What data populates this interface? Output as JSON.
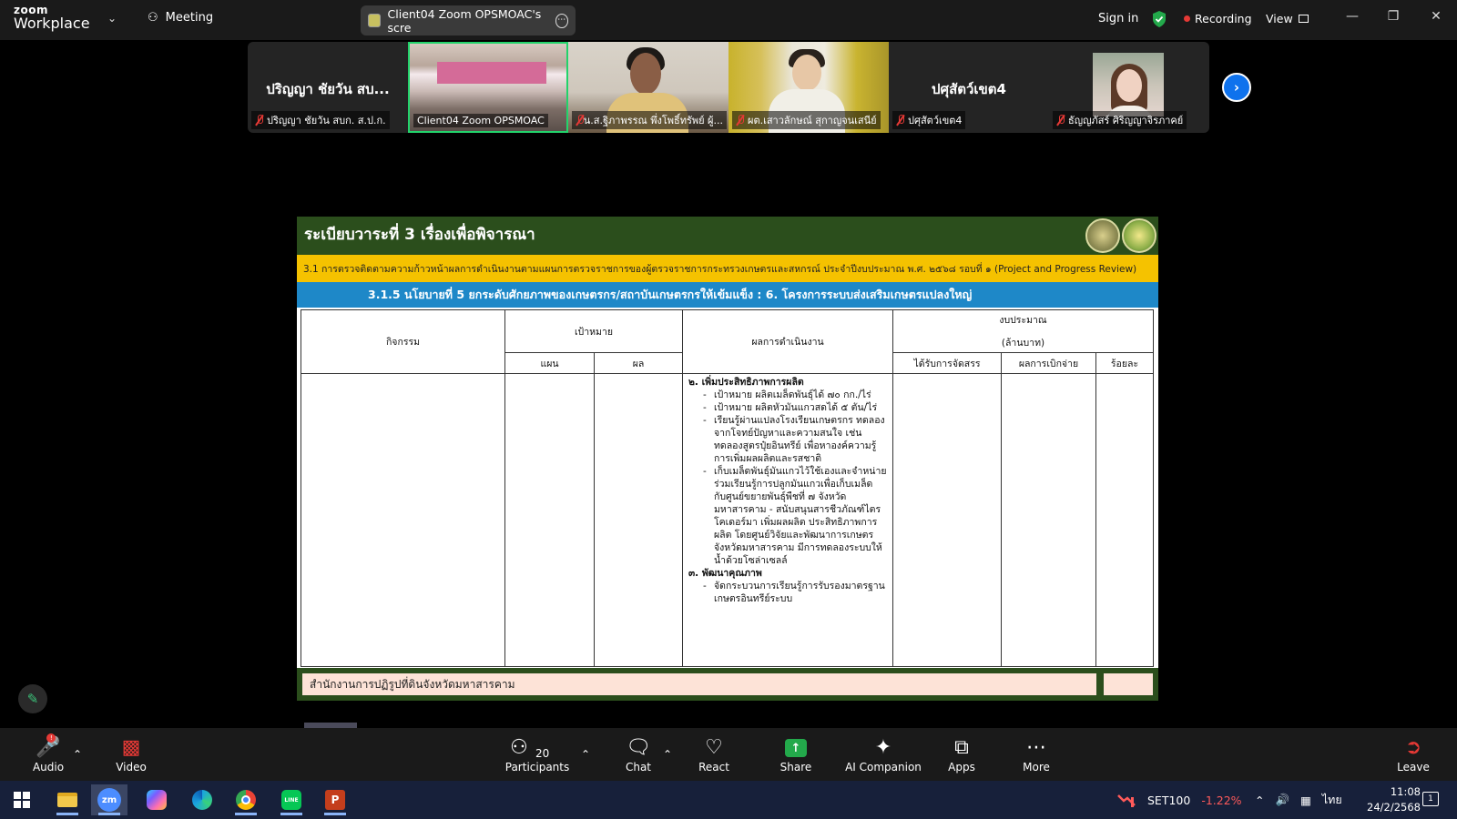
{
  "app": {
    "logo_line1": "zoom",
    "logo_line2": "Workplace",
    "meeting_label": "Meeting",
    "share_title": "Client04 Zoom OPSMOAC's scre",
    "sign_in": "Sign in",
    "recording": "Recording",
    "view": "View"
  },
  "participants": [
    {
      "big_name": "ปริญญา ชัยวัน สบ...",
      "label": "ปริญญา ชัยวัน สบก. ส.ป.ก.",
      "muted": true
    },
    {
      "big_name": "",
      "label": "Client04 Zoom OPSMOAC",
      "muted": false
    },
    {
      "big_name": "",
      "label": "น.ส.ฐิภาพรรณ พึ่งโพธิ์ทรัพย์ ผู้...",
      "muted": true
    },
    {
      "big_name": "",
      "label": "ผต.เสาวลักษณ์ สุกาญจนเสนีย์",
      "muted": true
    },
    {
      "big_name": "ปศุสัตว์เขต4",
      "label": "ปศุสัตว์เขต4",
      "muted": true
    },
    {
      "big_name": "",
      "label": "ธัญญภัสร์ ศิริญญาจิรภาคย์",
      "muted": true
    }
  ],
  "slide": {
    "title": "ระเบียบวาระที่ 3 เรื่องเพื่อพิจารณา",
    "subtitle_yellow": "3.1 การตรวจติดตามความก้าวหน้าผลการดำเนินงานตามแผนการตรวจราชการของผู้ตรวจราชการกระทรวงเกษตรและสหกรณ์ ประจำปีงบประมาณ พ.ศ. ๒๕๖๘ รอบที่ ๑ (Project and Progress Review)",
    "subtitle_blue": "3.1.5 นโยบายที่ 5 ยกระดับศักยภาพของเกษตรกร/สถาบันเกษตรกรให้เข้มแข็ง : 6. โครงการระบบส่งเสริมเกษตรแปลงใหญ่",
    "table": {
      "col_activity": "กิจกรรม",
      "col_target": "เป้าหมาย",
      "col_plan": "แผน",
      "col_result": "ผล",
      "col_outcome": "ผลการดำเนินงาน",
      "col_budget": "งบประมาณ",
      "col_budget_unit": "(ล้านบาท)",
      "col_allocated": "ได้รับการจัดสรร",
      "col_disbursed": "ผลการเบิกจ่าย",
      "col_percent": "ร้อยละ",
      "section2_heading": "๒. เพิ่มประสิทธิภาพการผลิต",
      "section2_items": [
        "เป้าหมาย ผลิตเมล็ดพันธุ์ได้ ๗๐ กก./ไร่",
        "เป้าหมาย ผลิตหัวมันแกวสดได้ ๕ ตัน/ไร่",
        "เรียนรู้ผ่านแปลงโรงเรียนเกษตรกร ทดลองจากโจทย์ปัญหาและความสนใจ เช่น ทดลองสูตรปุ๋ยอินทรีย์ เพื่อหาองค์ความรู้การเพิ่มผลผลิตและรสชาติ",
        "เก็บเมล็ดพันธุ์มันแกวไว้ใช้เองและจำหน่าย ร่วมเรียนรู้การปลูกมันแกวเพื่อเก็บเมล็ด กับศูนย์ขยายพันธุ์พืชที่ ๗ จังหวัดมหาสารคาม - สนับสนุนสารชีวภัณฑ์ไตรโคเดอร์มา เพิ่มผลผลิต ประสิทธิภาพการผลิต โดยศูนย์วิจัยและพัฒนาการเกษตรจังหวัดมหาสารคาม มีการทดลองระบบให้น้ำด้วยโซล่าเซลล์"
      ],
      "section3_heading": "๓. พัฒนาคุณภาพ",
      "section3_items": [
        "จัดกระบวนการเรียนรู้การรับรองมาตรฐานเกษตรอินทรีย์ระบบ"
      ]
    },
    "footer": "สำนักงานการปฏิรูปที่ดินจังหวัดมหาสารคาม"
  },
  "toolbar": {
    "audio": "Audio",
    "video": "Video",
    "participants": "Participants",
    "participants_count": "20",
    "chat": "Chat",
    "react": "React",
    "share": "Share",
    "ai_companion": "AI Companion",
    "apps": "Apps",
    "more": "More",
    "leave": "Leave"
  },
  "taskbar": {
    "zoom_app": "zm",
    "line_app": "LINE",
    "ppt_app": "P",
    "stock_name": "SET100",
    "stock_change": "-1.22%",
    "language": "ไทย",
    "time": "11:08",
    "date": "24/2/2568",
    "notifications": "1"
  },
  "colors": {
    "topbar": "#1a1a1a",
    "slide_green": "#2b4e1c",
    "slide_yellow": "#f5c200",
    "slide_blue": "#1e88c8",
    "footer_pink": "#fde3d7",
    "recording_red": "#e53935",
    "share_green": "#23a94b",
    "next_blue": "#0e72ed",
    "stock_red": "#ff5a5a",
    "taskbar": "#17203a"
  }
}
